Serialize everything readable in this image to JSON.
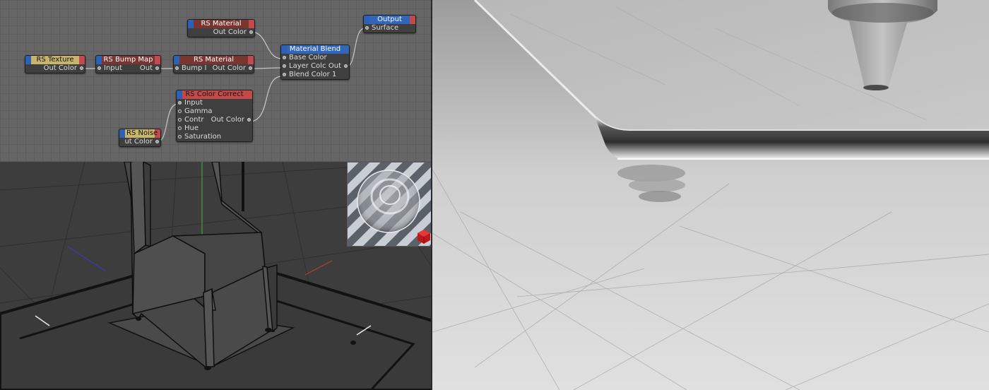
{
  "node_editor": {
    "nodes": {
      "rs_material_top": {
        "title": "RS Material",
        "outputs": [
          "Out Color"
        ]
      },
      "rs_texture": {
        "title": "RS Texture",
        "outputs": [
          "Out Color"
        ]
      },
      "rs_bump_map": {
        "title": "RS Bump Map",
        "inputs": [
          "Input"
        ],
        "outputs": [
          "Out"
        ]
      },
      "rs_material_mid": {
        "title": "RS Material",
        "inputs": [
          "Bump I"
        ],
        "outputs": [
          "Out Color"
        ]
      },
      "material_blend": {
        "title": "Material Blend",
        "inputs": [
          "Base Color",
          "Layer Colc",
          "Blend Color 1"
        ],
        "outputs": [
          "Out"
        ]
      },
      "output": {
        "title": "Output",
        "inputs": [
          "Surface"
        ]
      },
      "rs_color_correct": {
        "title": "RS Color Correct",
        "inputs": [
          "Input",
          "Gamma",
          "Contr",
          "Hue",
          "Saturation"
        ],
        "outputs": [
          "Out Color"
        ]
      },
      "rs_noise": {
        "title": "RS Noise",
        "outputs": [
          "ut Color"
        ]
      }
    }
  },
  "colors": {
    "port_blue": "#2b62b6",
    "material_header": "#7b3530",
    "texture_header": "#c9b46b",
    "color_correct_header": "#c44a4a",
    "blend_header": "#3266b8",
    "axis_x": "#b83a3a",
    "axis_y": "#3aa53a",
    "axis_z": "#3a3ab8"
  },
  "viewport": {
    "view": "perspective"
  },
  "render": {
    "scene": "grey render"
  }
}
